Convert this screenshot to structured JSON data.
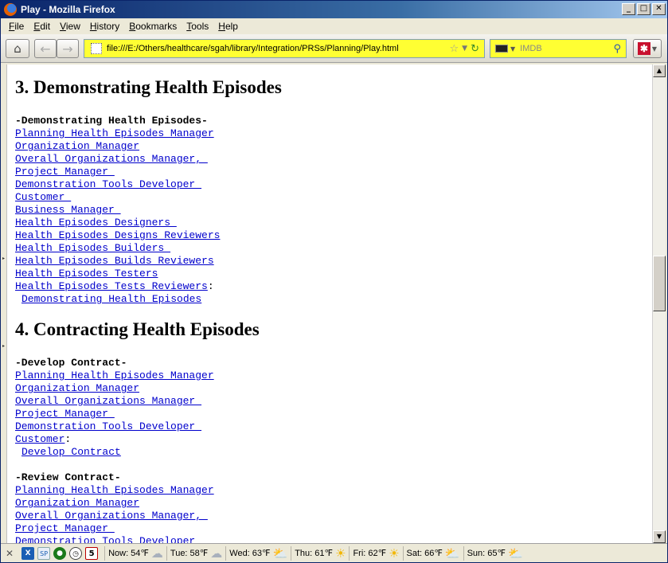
{
  "window": {
    "title": "Play - Mozilla Firefox",
    "controls": [
      "_",
      "□",
      "✕"
    ]
  },
  "menu": [
    "File",
    "Edit",
    "View",
    "History",
    "Bookmarks",
    "Tools",
    "Help"
  ],
  "menu_underline": [
    "F",
    "E",
    "V",
    "H",
    "B",
    "T",
    "H"
  ],
  "navbar": {
    "url": "file:///E:/Others/healthcare/sgah/library/Integration/PRSs/Planning/Play.html",
    "search_placeholder": "IMDB"
  },
  "page": {
    "sections": [
      {
        "heading": "3. Demonstrating Health Episodes",
        "groups": [
          {
            "title": "-Demonstrating Health Episodes-",
            "roles": [
              "Planning Health Episodes Manager",
              "Organization Manager",
              "Overall Organizations Manager, ",
              "Project Manager ",
              "Demonstration Tools Developer ",
              "Customer ",
              "Business Manager ",
              "Health Episodes Designers ",
              "Health Episodes Designs Reviewers",
              "Health Episodes Builders ",
              "Health Episodes Builds Reviewers",
              "Health Episodes Testers",
              "Health Episodes Tests Reviewers"
            ],
            "action": "Demonstrating Health Episodes"
          }
        ]
      },
      {
        "heading": "4. Contracting Health Episodes",
        "groups": [
          {
            "title": "-Develop Contract-",
            "roles": [
              "Planning Health Episodes Manager",
              "Organization Manager",
              "Overall Organizations Manager ",
              "Project Manager ",
              "Demonstration Tools Developer ",
              "Customer"
            ],
            "action": "Develop Contract"
          },
          {
            "title": "-Review Contract-",
            "roles": [
              "Planning Health Episodes Manager",
              "Organization Manager",
              "Overall Organizations Manager, ",
              "Project Manager ",
              "Demonstration Tools Developer "
            ]
          }
        ]
      }
    ]
  },
  "statusbar": {
    "calendar_day": "5",
    "weather": [
      {
        "label": "Now: 54℉",
        "icon": "cloud"
      },
      {
        "label": "Tue: 58℉",
        "icon": "cloud"
      },
      {
        "label": "Wed: 63℉",
        "icon": "partly-cloudy"
      },
      {
        "label": "Thu: 61℉",
        "icon": "sun"
      },
      {
        "label": "Fri: 62℉",
        "icon": "sun"
      },
      {
        "label": "Sat: 66℉",
        "icon": "partly-cloudy"
      },
      {
        "label": "Sun: 65℉",
        "icon": "partly-cloudy"
      }
    ]
  }
}
